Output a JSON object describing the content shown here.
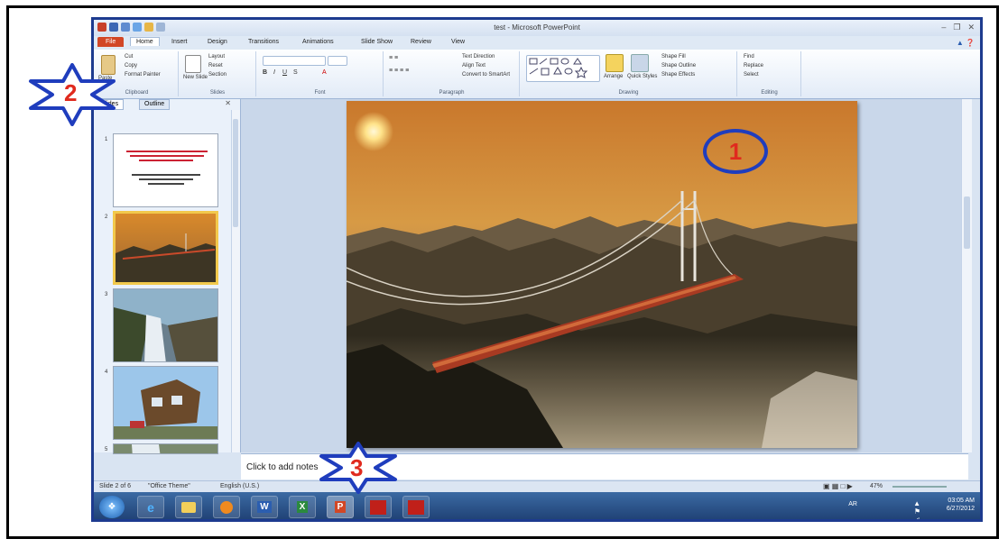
{
  "window": {
    "title": "test - Microsoft PowerPoint"
  },
  "ribbon": {
    "tabs": [
      "File",
      "Home",
      "Insert",
      "Design",
      "Transitions",
      "Animations",
      "Slide Show",
      "Review",
      "View"
    ],
    "clipboard": {
      "paste": "Paste",
      "cut": "Cut",
      "copy": "Copy",
      "format_painter": "Format Painter",
      "label": "Clipboard"
    },
    "slides": {
      "new_slide": "New Slide",
      "layout": "Layout",
      "reset": "Reset",
      "section": "Section",
      "label": "Slides"
    },
    "font": {
      "label": "Font"
    },
    "paragraph": {
      "text_direction": "Text Direction",
      "align_text": "Align Text",
      "smartart": "Convert to SmartArt",
      "label": "Paragraph"
    },
    "drawing": {
      "arrange": "Arrange",
      "quick_styles": "Quick Styles",
      "shape_fill": "Shape Fill",
      "shape_outline": "Shape Outline",
      "shape_effects": "Shape Effects",
      "label": "Drawing"
    },
    "editing": {
      "find": "Find",
      "replace": "Replace",
      "select": "Select",
      "label": "Editing"
    }
  },
  "pane": {
    "tabs": [
      "Slides",
      "Outline"
    ],
    "slide_numbers": [
      "1",
      "2",
      "3",
      "4",
      "5"
    ]
  },
  "notes": {
    "placeholder": "Click to add notes"
  },
  "status": {
    "slide_info": "Slide 2 of 6",
    "theme": "\"Office Theme\"",
    "language": "English (U.S.)",
    "zoom": "47%"
  },
  "tray": {
    "lang": "AR",
    "time": "03:05 AM",
    "date": "6/27/2012"
  },
  "annotations": {
    "one": "1",
    "two": "2",
    "three": "3"
  },
  "colors": {
    "accent_blue": "#1f3dbd",
    "annotation_red": "#e02a1e",
    "file_tab": "#d24726"
  }
}
